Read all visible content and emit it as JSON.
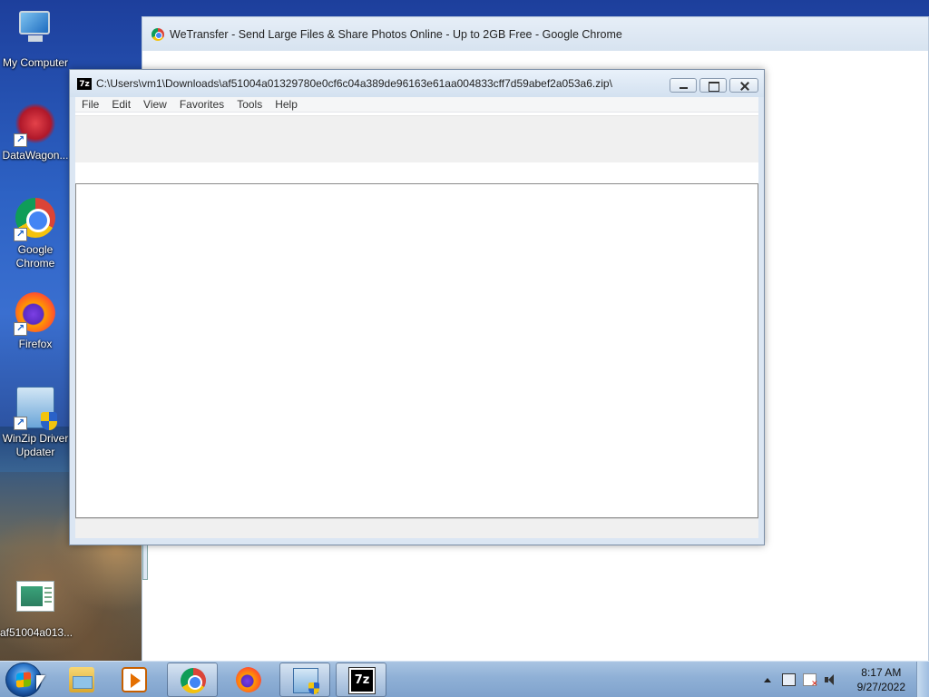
{
  "desktop": {
    "icons": [
      {
        "label": "My Computer",
        "icon": "computer-icon"
      },
      {
        "label": "DataWagon...",
        "icon": "datawagon-icon"
      },
      {
        "label": "Google Chrome",
        "icon": "chrome-icon"
      },
      {
        "label": "Firefox",
        "icon": "firefox-icon"
      },
      {
        "label": "WinZip Driver Updater",
        "icon": "winzip-driver-updater-icon"
      },
      {
        "label": "af51004a013...",
        "icon": "archive-file-icon"
      }
    ],
    "shortcut_glyph": "↗"
  },
  "chrome_window": {
    "title": "WeTransfer - Send Large Files & Share Photos Online - Up to 2GB Free - Google Chrome"
  },
  "zip_window": {
    "logo": "7z",
    "title": "C:\\Users\\vm1\\Downloads\\af51004a01329780e0cf6c04a389de96163e61aa004833cff7d59abef2a053a6.zip\\",
    "menu": [
      "File",
      "Edit",
      "View",
      "Favorites",
      "Tools",
      "Help"
    ]
  },
  "taskbar": {
    "items": [
      {
        "name": "windows-explorer",
        "icon": "folder-icon"
      },
      {
        "name": "media-player",
        "icon": "media-player-icon"
      },
      {
        "name": "google-chrome",
        "icon": "chrome-icon"
      },
      {
        "name": "firefox",
        "icon": "firefox-icon"
      },
      {
        "name": "winzip-driver-updater",
        "icon": "winzip-icon"
      },
      {
        "name": "7-zip",
        "icon": "7zip-icon",
        "label": "7z"
      }
    ],
    "clock": {
      "time": "8:17 AM",
      "date": "9/27/2022"
    }
  }
}
